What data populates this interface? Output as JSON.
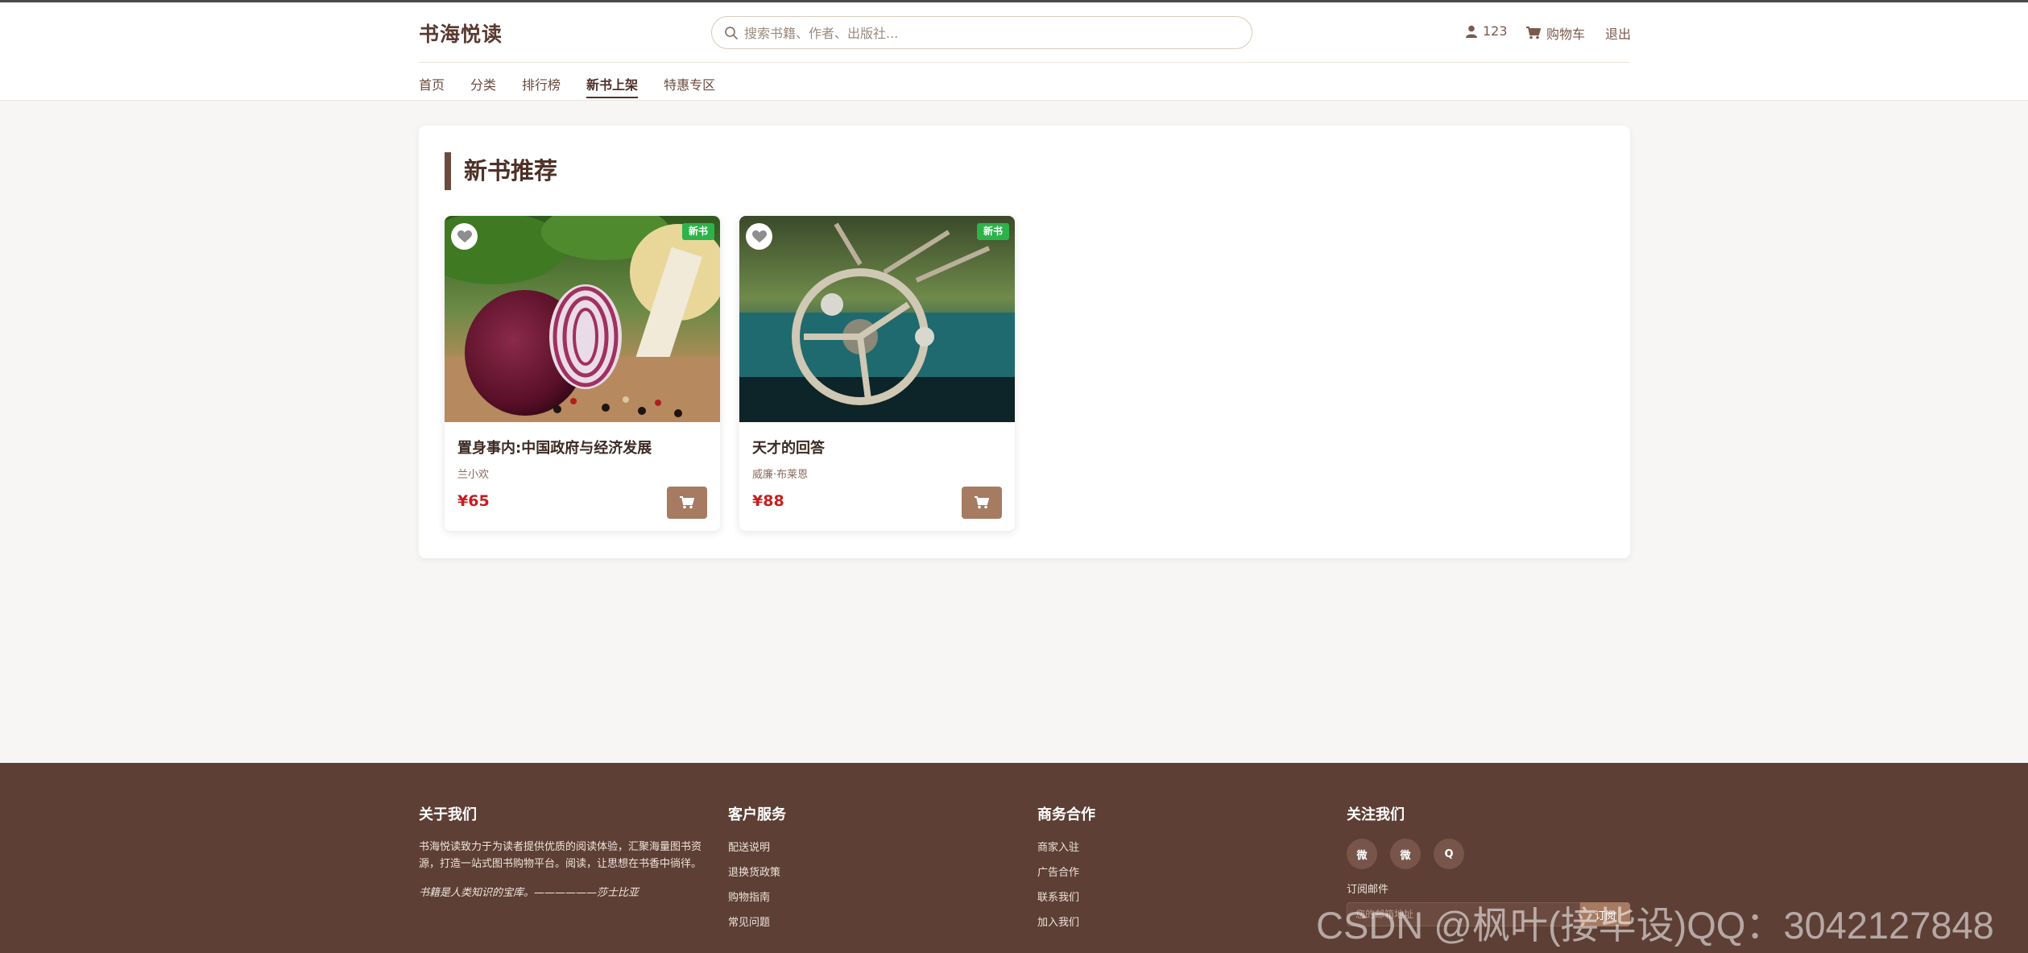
{
  "header": {
    "brand": "书海悦读",
    "search_placeholder": "搜索书籍、作者、出版社...",
    "user_label": "123",
    "cart_label": "购物车",
    "logout_label": "退出"
  },
  "nav": {
    "items": [
      {
        "label": "首页"
      },
      {
        "label": "分类"
      },
      {
        "label": "排行榜"
      },
      {
        "label": "新书上架"
      },
      {
        "label": "特惠专区"
      }
    ],
    "active": "新书上架"
  },
  "main": {
    "section_title": "新书推荐",
    "books": [
      {
        "title": "置身事内:中国政府与经济发展",
        "author": "兰小欢",
        "price": "¥65",
        "badge": "新书",
        "image": "onion-vegetables-photo"
      },
      {
        "title": "天才的回答",
        "author": "威廉·布莱恩",
        "price": "¥88",
        "badge": "新书",
        "image": "vintage-car-steering-wheel-photo"
      }
    ]
  },
  "footer": {
    "about": {
      "heading": "关于我们",
      "text": "书海悦读致力于为读者提供优质的阅读体验，汇聚海量图书资源，打造一站式图书购物平台。阅读，让思想在书香中徜徉。",
      "quote": "书籍是人类知识的宝库。——————莎士比亚"
    },
    "service": {
      "heading": "客户服务",
      "links": [
        "配送说明",
        "退换货政策",
        "购物指南",
        "常见问题"
      ]
    },
    "business": {
      "heading": "商务合作",
      "links": [
        "商家入驻",
        "广告合作",
        "联系我们",
        "加入我们"
      ]
    },
    "follow": {
      "heading": "关注我们",
      "social": [
        "微",
        "微",
        "Q"
      ],
      "subscribe_label": "订阅邮件",
      "subscribe_placeholder": "您的邮箱地址",
      "subscribe_button": "订阅"
    }
  },
  "watermark": "CSDN @枫叶(接毕设)QQ：3042127848",
  "colors": {
    "brand_brown": "#5d3f35",
    "accent": "#a77a62",
    "price_red": "#c81e1e",
    "badge_green": "#2db34a"
  }
}
